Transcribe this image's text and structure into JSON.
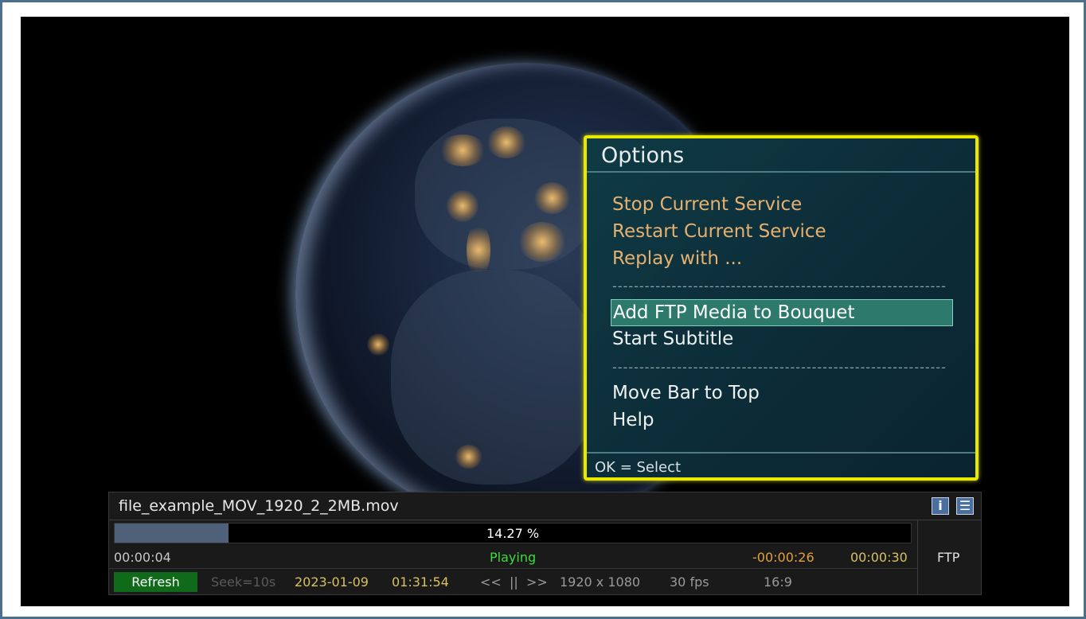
{
  "options_menu": {
    "title": "Options",
    "items": [
      {
        "label": "Stop Current Service",
        "style": "orange"
      },
      {
        "label": "Restart Current Service",
        "style": "orange"
      },
      {
        "label": "Replay with ...",
        "style": "orange"
      },
      {
        "label": "Add FTP Media to Bouquet",
        "style": "selected"
      },
      {
        "label": "Start Subtitle",
        "style": "white"
      },
      {
        "label": "Move Bar to Top",
        "style": "white"
      },
      {
        "label": "Help",
        "style": "white"
      }
    ],
    "separator": "--------------------------------------------------------------",
    "footer": "OK = Select"
  },
  "player_bar": {
    "filename": "file_example_MOV_1920_2_2MB.mov",
    "info_icon": "i",
    "menu_icon": "☰",
    "progress_text": "14.27 %",
    "progress_fraction": 0.1427,
    "elapsed": "00:00:04",
    "status": "Playing",
    "remaining": "-00:00:26",
    "duration": "00:00:30",
    "source": "FTP",
    "refresh_label": "Refresh",
    "seek": "Seek=10s",
    "date": "2023-01-09",
    "time": "01:31:54",
    "transport": "<<  ||  >>",
    "resolution": "1920 x 1080",
    "fps": "30 fps",
    "aspect": "16:9"
  },
  "colors": {
    "menu_border": "#e8e800",
    "menu_item_orange": "#e6b070",
    "selected_bg": "#2d7a6c",
    "status_green": "#3ddc3d",
    "time_yellow": "#d8c060",
    "remaining_orange": "#e0a040",
    "refresh_bg": "#0f6a1a"
  }
}
